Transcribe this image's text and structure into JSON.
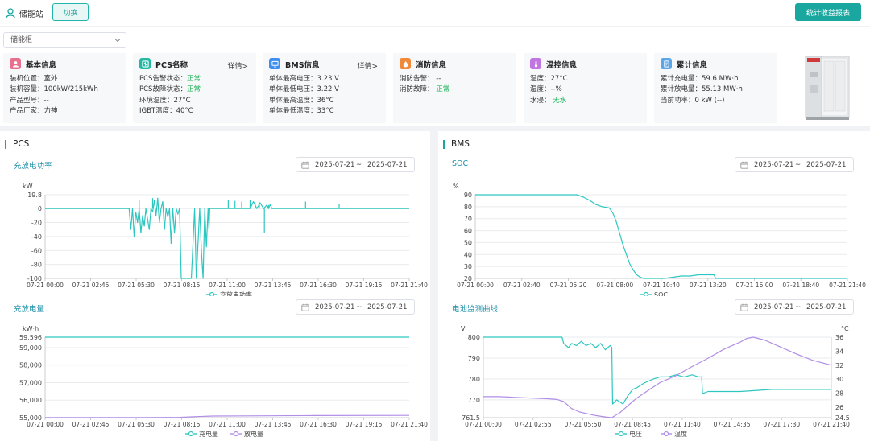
{
  "header": {
    "station_name": "储能站",
    "switch_label": "切换",
    "report_label": "统计收益报表"
  },
  "selector": {
    "value": "储能柜"
  },
  "cards": {
    "basic": {
      "title": "基本信息",
      "rows": [
        "装机位置：室外",
        "装机容量：100kW/215kWh",
        "产品型号：--",
        "产品厂家：力神"
      ]
    },
    "pcs": {
      "title": "PCS名称",
      "more": "详情>",
      "alarm_label": "PCS告警状态：",
      "alarm_value": "正常",
      "fault_label": "PCS故障状态：",
      "fault_value": "正常",
      "env_temp": "环境温度：27°C",
      "igbt_temp": "IGBT温度：40°C"
    },
    "bms": {
      "title": "BMS信息",
      "more": "详情>",
      "rows": [
        "单体最高电压：3.23 V",
        "单体最低电压：3.22 V",
        "单体最高温度：36°C",
        "单体最低温度：33°C"
      ]
    },
    "fire": {
      "title": "消防信息",
      "alarm": "消防告警：  --",
      "fault_label": "消防故障：  ",
      "fault_value": "正常"
    },
    "thermal": {
      "title": "温控信息",
      "temp": "温度：27°C",
      "humidity": "湿度：--%",
      "water_label": "水浸：  ",
      "water_value": "无水"
    },
    "totals": {
      "title": "累计信息",
      "rows": [
        "累计充电量：59.6 MW·h",
        "累计放电量：55.13 MW·h",
        "当前功率：0 kW (--)"
      ]
    }
  },
  "panels": {
    "pcs": "PCS",
    "bms": "BMS"
  },
  "date_range": {
    "start": "2025-07-21",
    "sep": "~",
    "end": "2025-07-21"
  },
  "colors": {
    "teal": "#1aa79f",
    "line1": "#2ec7c0",
    "line2": "#b18ee6",
    "ok": "#1fb55a"
  },
  "chart_data": [
    {
      "id": "pcs_power",
      "type": "line",
      "title": "充放电功率",
      "ylabel": "kW",
      "ylim": [
        -100,
        19.8
      ],
      "yticks": [
        19.8,
        0,
        -20,
        -40,
        -60,
        -80,
        -100
      ],
      "xlabels": [
        "07-21 00:00",
        "07-21 02:45",
        "07-21 05:30",
        "07-21 08:15",
        "07-21 11:00",
        "07-21 13:45",
        "07-21 16:30",
        "07-21 19:15",
        "07-21 21:40"
      ],
      "series": [
        {
          "name": "充放电功率",
          "color": "#2ec7c0",
          "x": [
            0.0,
            5.0,
            5.1,
            5.2,
            5.3,
            5.4,
            5.5,
            5.6,
            5.7,
            5.8,
            5.9,
            6.0,
            6.1,
            6.2,
            6.3,
            6.4,
            6.5,
            6.6,
            6.7,
            6.8,
            6.9,
            7.0,
            7.1,
            7.2,
            7.3,
            7.4,
            7.5,
            7.6,
            7.7,
            7.8,
            7.9,
            8.0,
            8.1,
            8.15,
            8.2,
            8.3,
            8.5,
            8.7,
            8.9,
            9.0,
            9.1,
            9.2,
            9.3,
            9.4,
            9.5,
            9.6,
            9.7,
            9.75,
            9.8,
            9.85,
            9.9,
            10.2,
            10.4,
            10.6,
            10.8,
            11.2,
            11.4,
            11.6,
            11.8,
            12.0,
            12.2,
            12.4,
            12.6,
            12.8,
            13.0,
            13.2,
            13.3,
            13.4,
            13.5,
            13.7,
            14.0,
            14.2,
            14.4,
            14.6,
            14.8,
            15.0,
            15.2,
            15.4,
            15.6,
            15.8,
            16.0,
            16.2,
            16.4,
            16.6,
            16.8,
            17.0,
            17.2,
            17.4,
            17.6,
            17.8,
            18.0,
            18.2,
            18.4,
            18.8,
            19.0,
            19.5,
            20.0,
            20.5,
            21.0,
            21.67
          ],
          "y": [
            0,
            0,
            -30,
            0,
            -40,
            -5,
            -20,
            0,
            -35,
            -10,
            -25,
            0,
            -15,
            -30,
            0,
            -5,
            12,
            -10,
            15,
            -20,
            0,
            10,
            -30,
            0,
            -12,
            0,
            -50,
            0,
            -35,
            0,
            -8,
            0,
            -100,
            -100,
            -100,
            -100,
            -100,
            -100,
            0,
            -100,
            -50,
            0,
            -60,
            -100,
            0,
            -55,
            0,
            -30,
            0,
            0,
            0,
            0,
            0,
            0,
            0,
            0,
            0,
            0,
            0,
            0,
            0,
            10,
            0,
            8,
            0,
            5,
            0,
            6,
            0,
            0,
            0,
            0,
            0,
            0,
            0,
            0,
            0,
            0,
            0,
            0,
            0,
            0,
            0,
            0,
            0,
            0,
            0,
            0,
            0,
            0,
            0,
            0,
            0,
            0,
            0,
            0,
            0,
            0,
            0,
            0
          ]
        }
      ],
      "spikes": [
        {
          "x": 10.9,
          "y": 12
        },
        {
          "x": 11.3,
          "y": 11
        },
        {
          "x": 11.7,
          "y": 10
        },
        {
          "x": 12.2,
          "y": 12
        },
        {
          "x": 12.5,
          "y": 8
        },
        {
          "x": 12.75,
          "y": 9
        },
        {
          "x": 13.05,
          "y": -35
        },
        {
          "x": 13.3,
          "y": 5
        },
        {
          "x": 15.5,
          "y": 10
        },
        {
          "x": 17.5,
          "y": 6
        },
        {
          "x": 5.6,
          "y": 12
        },
        {
          "x": 6.4,
          "y": 15
        }
      ]
    },
    {
      "id": "energy",
      "type": "line",
      "title": "充放电量",
      "ylabel": "kW·h",
      "ylim": [
        55000,
        59596
      ],
      "yticks": [
        59596,
        59000,
        58000,
        57000,
        56000,
        55000
      ],
      "ytick_labels": [
        "59,596",
        "59,000",
        "58,000",
        "57,000",
        "56,000",
        "55,000"
      ],
      "xlabels": [
        "07-21 00:00",
        "07-21 02:45",
        "07-21 05:30",
        "07-21 08:15",
        "07-21 11:00",
        "07-21 13:45",
        "07-21 16:30",
        "07-21 19:15",
        "07-21 21:40"
      ],
      "series": [
        {
          "name": "充电量",
          "color": "#2ec7c0",
          "x": [
            0,
            21.67
          ],
          "y": [
            59596,
            59596
          ]
        },
        {
          "name": "放电量",
          "color": "#b18ee6",
          "x": [
            0,
            6,
            8,
            9,
            10,
            12,
            16,
            21.67
          ],
          "y": [
            55010,
            55010,
            55020,
            55060,
            55090,
            55100,
            55120,
            55130
          ]
        }
      ]
    },
    {
      "id": "soc",
      "type": "line",
      "title": "SOC",
      "ylabel": "%",
      "ylim": [
        20,
        90
      ],
      "yticks": [
        90,
        80,
        70,
        60,
        50,
        40,
        30,
        20
      ],
      "xlabels": [
        "07-21 00:00",
        "07-21 02:40",
        "07-21 05:20",
        "07-21 08:00",
        "07-21 10:40",
        "07-21 13:20",
        "07-21 16:00",
        "07-21 18:40",
        "07-21 21:40"
      ],
      "series": [
        {
          "name": "SOC",
          "color": "#2ec7c0",
          "x": [
            0,
            5.9,
            6.3,
            6.7,
            7.0,
            7.4,
            7.8,
            8.0,
            8.2,
            8.4,
            8.6,
            8.8,
            9.0,
            9.2,
            9.4,
            9.6,
            9.8,
            10.0,
            10.3,
            10.6,
            11.0,
            11.5,
            12.0,
            12.5,
            13.0,
            13.5,
            13.9,
            14.0,
            15.0,
            18.0,
            21.67
          ],
          "y": [
            90,
            90,
            88,
            85,
            82,
            80,
            79,
            75,
            68,
            58,
            48,
            40,
            32,
            27,
            23,
            21,
            20,
            20,
            20,
            20,
            20,
            21,
            22,
            22,
            23,
            23,
            23,
            20,
            20,
            20,
            20
          ]
        }
      ]
    },
    {
      "id": "battery",
      "type": "line",
      "title": "电池监测曲线",
      "ylabel": "V",
      "ylabel_right": "°C",
      "ylim": [
        761.5,
        800
      ],
      "yticks": [
        800,
        790,
        780,
        770,
        761.5
      ],
      "ylim_right": [
        24.5,
        36
      ],
      "yticks_right": [
        36,
        34,
        32,
        30,
        28,
        26,
        24.5
      ],
      "xlabels": [
        "07-21 00:00",
        "07-21 02:55",
        "07-21 05:50",
        "07-21 08:45",
        "07-21 11:40",
        "07-21 14:35",
        "07-21 17:30",
        "07-21 21:40"
      ],
      "series": [
        {
          "name": "电压",
          "color": "#2ec7c0",
          "axis": "left",
          "x": [
            0,
            4.9,
            5.0,
            5.3,
            5.5,
            5.8,
            6.1,
            6.4,
            6.7,
            7.0,
            7.3,
            7.6,
            7.9,
            8.0,
            8.05,
            8.3,
            8.7,
            9.0,
            9.3,
            9.6,
            10.0,
            10.3,
            10.6,
            11.0,
            11.5,
            12.0,
            12.5,
            13.0,
            13.4,
            13.6,
            13.65,
            14.0,
            16.0,
            18.0,
            21.67
          ],
          "y": [
            800,
            800,
            797,
            795,
            797,
            796,
            798,
            796,
            797,
            795,
            797,
            794,
            796,
            795,
            768,
            770,
            768,
            772,
            775,
            776,
            778,
            779,
            780,
            781,
            781,
            782,
            781,
            782,
            781,
            781,
            773,
            774,
            774,
            775,
            775
          ]
        },
        {
          "name": "温度",
          "color": "#b18ee6",
          "axis": "right",
          "x": [
            0,
            1,
            2,
            3,
            4,
            4.6,
            5.0,
            5.5,
            6.0,
            6.6,
            7.0,
            7.6,
            8.0,
            8.5,
            9.0,
            9.5,
            10.0,
            11.0,
            12.0,
            13.0,
            14.0,
            15.0,
            16.0,
            16.4,
            16.8,
            17.5,
            18.5,
            19.5,
            20.5,
            21.67
          ],
          "y": [
            27.5,
            27.5,
            27.4,
            27.3,
            27.2,
            27.1,
            26.8,
            25.8,
            25.3,
            25.0,
            24.8,
            24.6,
            24.5,
            25.2,
            26.2,
            27.2,
            28.0,
            29.5,
            30.5,
            31.8,
            33.0,
            34.3,
            35.3,
            35.8,
            36.0,
            35.6,
            34.6,
            33.6,
            32.7,
            32.0
          ]
        }
      ]
    }
  ]
}
